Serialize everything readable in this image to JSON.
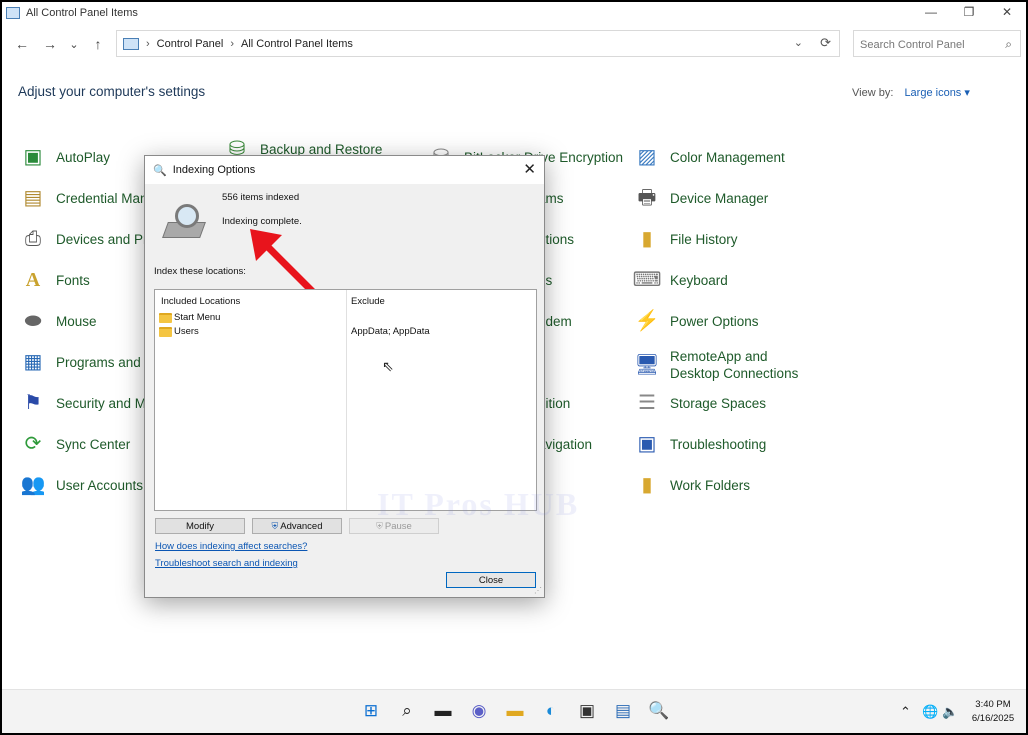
{
  "window": {
    "title": "All Control Panel Items",
    "controls": {
      "minimize": "—",
      "restore": "❐",
      "close": "✕"
    }
  },
  "nav": {
    "back": "←",
    "forward": "→",
    "recent": "⌄",
    "up": "↑",
    "breadcrumb": [
      "Control Panel",
      "All Control Panel Items"
    ],
    "search_placeholder": "Search Control Panel"
  },
  "heading": "Adjust your computer's settings",
  "view_by": {
    "label": "View by:",
    "value": "Large icons ▾"
  },
  "items": {
    "autoplay": "AutoPlay",
    "backup": "Backup and Restore",
    "bitlocker": "BitLocker Drive Encryption",
    "color": "Color Management",
    "credential": "Credential Mana",
    "programs_partial": "ams",
    "device_manager": "Device Manager",
    "devices": "Devices and Prir",
    "options_partial": "ptions",
    "file_history": "File History",
    "fonts": "Fonts",
    "ns_partial": "ns",
    "keyboard": "Keyboard",
    "mouse": "Mouse",
    "modem_partial": "odem",
    "power": "Power Options",
    "programs_features": "Programs and F",
    "remoteapp": "RemoteApp and Desktop Connections",
    "security": "Security and Ma",
    "recognition_partial": "nition",
    "storage": "Storage Spaces",
    "sync": "Sync Center",
    "navigation_partial": "avigation",
    "troubleshooting": "Troubleshooting",
    "user_accounts": "User Accounts",
    "s_partial": "s",
    "work_folders": "Work Folders"
  },
  "dialog": {
    "title": "Indexing Options",
    "items_indexed": "556 items indexed",
    "status": "Indexing complete.",
    "index_label": "Index these locations:",
    "col_included": "Included Locations",
    "col_exclude": "Exclude",
    "locations": [
      {
        "name": "Start Menu",
        "exclude": ""
      },
      {
        "name": "Users",
        "exclude": "AppData; AppData"
      }
    ],
    "watermark": "IT Pros HUB",
    "buttons": {
      "modify": "Modify",
      "advanced": "Advanced",
      "pause": "Pause",
      "close": "Close"
    },
    "links": {
      "how": "How does indexing affect searches?",
      "troubleshoot": "Troubleshoot search and indexing"
    }
  },
  "taskbar": {
    "time": "3:40 PM",
    "date": "6/16/2025"
  }
}
